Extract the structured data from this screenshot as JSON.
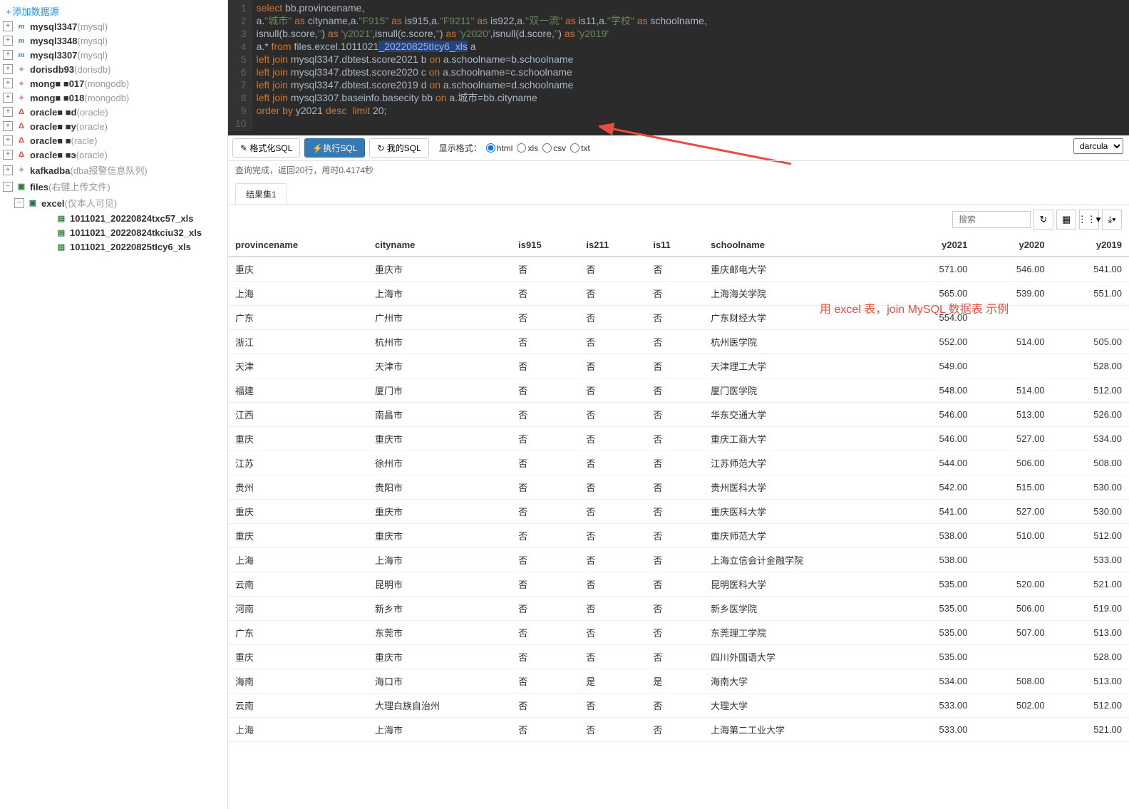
{
  "sidebar": {
    "add_link": "添加数据源",
    "items": [
      {
        "icon": "mysql",
        "iconText": "m",
        "label": "mysql3347",
        "type": "(mysql)",
        "expand": "plus"
      },
      {
        "icon": "mysql",
        "iconText": "m",
        "label": "mysql3348",
        "type": "(mysql)",
        "expand": "plus"
      },
      {
        "icon": "mysql",
        "iconText": "m",
        "label": "mysql3307",
        "type": "(mysql)",
        "expand": "plus"
      },
      {
        "icon": "dorisdb",
        "iconText": "✦",
        "label": "dorisdb93",
        "type": "(dorisdb)",
        "expand": "plus"
      },
      {
        "icon": "mongodb",
        "iconText": "✦",
        "label": "mong■ ■017",
        "type": "(mongodb)",
        "expand": "plus"
      },
      {
        "icon": "mongodb",
        "iconText": "✦",
        "label": "mong■ ■018",
        "type": "(mongodb)",
        "expand": "plus"
      },
      {
        "icon": "oracle",
        "iconText": "Δ",
        "label": "oracle■ ■d",
        "type": "(oracle)",
        "expand": "plus"
      },
      {
        "icon": "oracle",
        "iconText": "Δ",
        "label": "oracle■ ■y",
        "type": "(oracle)",
        "expand": "plus"
      },
      {
        "icon": "oracle",
        "iconText": "Δ",
        "label": "oracle■ ■",
        "type": "(racle)",
        "expand": "plus"
      },
      {
        "icon": "oracle",
        "iconText": "Δ",
        "label": "oracle■ ■э",
        "type": "(oracle)",
        "expand": "plus"
      },
      {
        "icon": "kafka",
        "iconText": "✦",
        "label": "kafkadba",
        "type": "(dba报警信息队列)",
        "expand": "plus"
      },
      {
        "icon": "folder",
        "iconText": "▣",
        "label": "files",
        "type": "(右键上传文件)",
        "expand": "minus"
      }
    ],
    "excel": {
      "label": "excel",
      "type": "(仅本人可见)",
      "expand": "minus"
    },
    "files": [
      {
        "label": "1011021_20220824txc57_xls"
      },
      {
        "label": "1011021_20220824tkciu32_xls"
      },
      {
        "label": "1011021_20220825tIcy6_xls"
      }
    ]
  },
  "editor": {
    "lines": [
      "1",
      "2",
      "3",
      "4",
      "5",
      "6",
      "7",
      "8",
      "9",
      "10"
    ]
  },
  "annotation": "用 excel 表，join MySQL 数据表 示例",
  "toolbar": {
    "format": "✎ 格式化SQL",
    "execute": "⚡执行SQL",
    "my_sql": "↻ 我的SQL",
    "display_label": "显示格式：",
    "opts": [
      "html",
      "xls",
      "csv",
      "txt"
    ],
    "theme": "darcula"
  },
  "status": "查询完成，返回20行，用时0.4174秒",
  "tabs": [
    "结果集1"
  ],
  "search_placeholder": "搜索",
  "columns": [
    "provincename",
    "cityname",
    "is915",
    "is211",
    "is11",
    "schoolname",
    "y2021",
    "y2020",
    "y2019"
  ],
  "rows": [
    [
      "重庆",
      "重庆市",
      "否",
      "否",
      "否",
      "重庆邮电大学",
      "571.00",
      "546.00",
      "541.00"
    ],
    [
      "上海",
      "上海市",
      "否",
      "否",
      "否",
      "上海海关学院",
      "565.00",
      "539.00",
      "551.00"
    ],
    [
      "广东",
      "广州市",
      "否",
      "否",
      "否",
      "广东财经大学",
      "554.00",
      "",
      ""
    ],
    [
      "浙江",
      "杭州市",
      "否",
      "否",
      "否",
      "杭州医学院",
      "552.00",
      "514.00",
      "505.00"
    ],
    [
      "天津",
      "天津市",
      "否",
      "否",
      "否",
      "天津理工大学",
      "549.00",
      "",
      "528.00"
    ],
    [
      "福建",
      "厦门市",
      "否",
      "否",
      "否",
      "厦门医学院",
      "548.00",
      "514.00",
      "512.00"
    ],
    [
      "江西",
      "南昌市",
      "否",
      "否",
      "否",
      "华东交通大学",
      "546.00",
      "513.00",
      "526.00"
    ],
    [
      "重庆",
      "重庆市",
      "否",
      "否",
      "否",
      "重庆工商大学",
      "546.00",
      "527.00",
      "534.00"
    ],
    [
      "江苏",
      "徐州市",
      "否",
      "否",
      "否",
      "江苏师范大学",
      "544.00",
      "506.00",
      "508.00"
    ],
    [
      "贵州",
      "贵阳市",
      "否",
      "否",
      "否",
      "贵州医科大学",
      "542.00",
      "515.00",
      "530.00"
    ],
    [
      "重庆",
      "重庆市",
      "否",
      "否",
      "否",
      "重庆医科大学",
      "541.00",
      "527.00",
      "530.00"
    ],
    [
      "重庆",
      "重庆市",
      "否",
      "否",
      "否",
      "重庆师范大学",
      "538.00",
      "510.00",
      "512.00"
    ],
    [
      "上海",
      "上海市",
      "否",
      "否",
      "否",
      "上海立信会计金融学院",
      "538.00",
      "",
      "533.00"
    ],
    [
      "云南",
      "昆明市",
      "否",
      "否",
      "否",
      "昆明医科大学",
      "535.00",
      "520.00",
      "521.00"
    ],
    [
      "河南",
      "新乡市",
      "否",
      "否",
      "否",
      "新乡医学院",
      "535.00",
      "506.00",
      "519.00"
    ],
    [
      "广东",
      "东莞市",
      "否",
      "否",
      "否",
      "东莞理工学院",
      "535.00",
      "507.00",
      "513.00"
    ],
    [
      "重庆",
      "重庆市",
      "否",
      "否",
      "否",
      "四川外国语大学",
      "535.00",
      "",
      "528.00"
    ],
    [
      "海南",
      "海口市",
      "否",
      "是",
      "是",
      "海南大学",
      "534.00",
      "508.00",
      "513.00"
    ],
    [
      "云南",
      "大理白族自治州",
      "否",
      "否",
      "否",
      "大理大学",
      "533.00",
      "502.00",
      "512.00"
    ],
    [
      "上海",
      "上海市",
      "否",
      "否",
      "否",
      "上海第二工业大学",
      "533.00",
      "",
      "521.00"
    ]
  ]
}
